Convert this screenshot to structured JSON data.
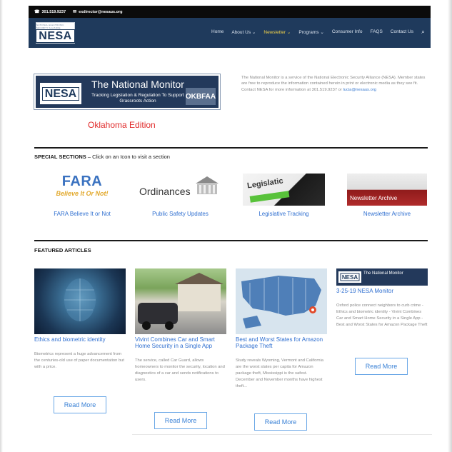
{
  "topbar": {
    "phone": "301.519.9237",
    "email": "exdirector@nesaus.org"
  },
  "header": {
    "logo_text": "NESA",
    "logo_tagline": "NATIONAL ELECTRONIC SECURITY ALLIANCE"
  },
  "nav": {
    "items": [
      "Home",
      "About Us",
      "Newsletter",
      "Programs",
      "Consumer Info",
      "FAQS",
      "Contact Us"
    ],
    "active": "Newsletter",
    "dropdowns": [
      "About Us",
      "Newsletter",
      "Programs"
    ]
  },
  "banner": {
    "logo_text": "NESA",
    "title": "The National Monitor",
    "subtitle": "Tracking Legislation & Regulation To Support Grassroots Action",
    "state_badge": "OKBFAA"
  },
  "edition": "Oklahoma Edition",
  "intro": {
    "text": "The National Monitor is a service of the National Electronic Security Alliance (NESA). Member states are free to reproduce the information contained herein in print or electronic media as they see fit. Contact NESA for more information at 301.519.9237 or",
    "link": "lucia@nesaus.org"
  },
  "special": {
    "heading": "SPECIAL SECTIONS",
    "subheading": " – Click on an Icon to visit a section",
    "items": [
      {
        "label": "FARA Believe It or Not",
        "icon_title": "FARA",
        "icon_sub": "Believe It Or Not!"
      },
      {
        "label": "Public Safety Updates",
        "icon_title": "Ordinances"
      },
      {
        "label": "Legislative Tracking",
        "icon_title": "Legislatic"
      },
      {
        "label": "Newsletter Archive",
        "icon_title": "Newsletter Archive"
      }
    ]
  },
  "featured": {
    "heading": "FEATURED ARTICLES",
    "articles": [
      {
        "title": "Ethics and biometric identity",
        "body": "Biometrics represent a huge advancement from the centuries-old use of paper documentation but with a price.",
        "button": "Read More"
      },
      {
        "title": "Vivint Combines Car and Smart Home Security in a Single App",
        "body": "The service, called Car Guard, allows homeowners to monitor the security, location and diagnostics of a car and sends notifications to users.",
        "button": "Read More"
      },
      {
        "title": "Best and Worst States for Amazon Package Theft",
        "body": "Study reveals Wyoming, Vermont and California are the worst states per capita for Amazon package theft, Mississippi is the safest. December and November months have highest theft...",
        "button": "Read More"
      },
      {
        "title": "3-25-19 NESA Monitor",
        "body": "Oxford police connect neighbors to curb crime - Ethics and biometric identity - Vivint Combines Car and Smart Home Security in a Single App - Best and Worst States for Amazon Package Theft",
        "button": "Read More",
        "thumb_title": "The National Monitor"
      }
    ]
  }
}
